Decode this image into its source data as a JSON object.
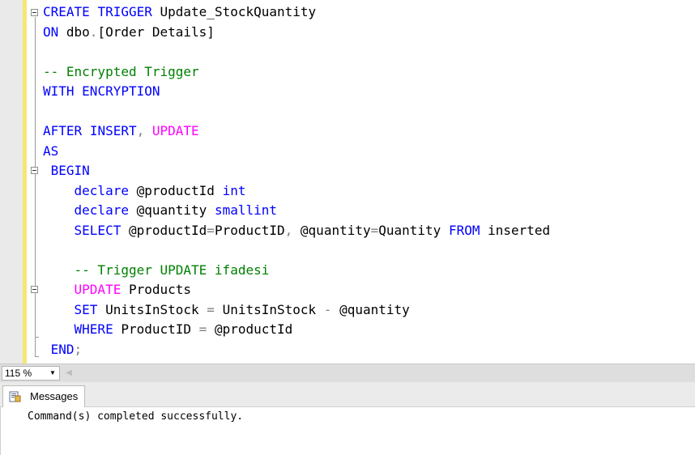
{
  "editor": {
    "lines": [
      [
        {
          "t": "CREATE",
          "c": "kw"
        },
        {
          "t": " ",
          "c": "tx"
        },
        {
          "t": "TRIGGER",
          "c": "kw"
        },
        {
          "t": " Update_StockQuantity",
          "c": "tx"
        }
      ],
      [
        {
          "t": "ON",
          "c": "kw"
        },
        {
          "t": " dbo",
          "c": "tx"
        },
        {
          "t": ".",
          "c": "op"
        },
        {
          "t": "[Order Details]",
          "c": "tx"
        }
      ],
      [],
      [
        {
          "t": "-- Encrypted Trigger",
          "c": "cm"
        }
      ],
      [
        {
          "t": "WITH",
          "c": "kw"
        },
        {
          "t": " ",
          "c": "tx"
        },
        {
          "t": "ENCRYPTION",
          "c": "kw"
        }
      ],
      [],
      [
        {
          "t": "AFTER",
          "c": "kw"
        },
        {
          "t": " ",
          "c": "tx"
        },
        {
          "t": "INSERT",
          "c": "kw"
        },
        {
          "t": ",",
          "c": "op"
        },
        {
          "t": " ",
          "c": "tx"
        },
        {
          "t": "UPDATE",
          "c": "pk"
        }
      ],
      [
        {
          "t": "AS",
          "c": "kw"
        }
      ],
      [
        {
          "t": " BEGIN",
          "c": "kw"
        }
      ],
      [
        {
          "t": "    ",
          "c": "tx"
        },
        {
          "t": "declare",
          "c": "kw"
        },
        {
          "t": " @productId ",
          "c": "tx"
        },
        {
          "t": "int",
          "c": "kw"
        }
      ],
      [
        {
          "t": "    ",
          "c": "tx"
        },
        {
          "t": "declare",
          "c": "kw"
        },
        {
          "t": " @quantity ",
          "c": "tx"
        },
        {
          "t": "smallint",
          "c": "kw"
        }
      ],
      [
        {
          "t": "    ",
          "c": "tx"
        },
        {
          "t": "SELECT",
          "c": "kw"
        },
        {
          "t": " @productId",
          "c": "tx"
        },
        {
          "t": "=",
          "c": "op"
        },
        {
          "t": "ProductID",
          "c": "tx"
        },
        {
          "t": ",",
          "c": "op"
        },
        {
          "t": " @quantity",
          "c": "tx"
        },
        {
          "t": "=",
          "c": "op"
        },
        {
          "t": "Quantity ",
          "c": "tx"
        },
        {
          "t": "FROM",
          "c": "kw"
        },
        {
          "t": " inserted",
          "c": "tx"
        }
      ],
      [],
      [
        {
          "t": "    ",
          "c": "tx"
        },
        {
          "t": "-- Trigger UPDATE ifadesi",
          "c": "cm"
        }
      ],
      [
        {
          "t": "    ",
          "c": "tx"
        },
        {
          "t": "UPDATE",
          "c": "pk"
        },
        {
          "t": " Products",
          "c": "tx"
        }
      ],
      [
        {
          "t": "    ",
          "c": "tx"
        },
        {
          "t": "SET",
          "c": "kw"
        },
        {
          "t": " UnitsInStock ",
          "c": "tx"
        },
        {
          "t": "=",
          "c": "op"
        },
        {
          "t": " UnitsInStock ",
          "c": "tx"
        },
        {
          "t": "-",
          "c": "op"
        },
        {
          "t": " @quantity",
          "c": "tx"
        }
      ],
      [
        {
          "t": "    ",
          "c": "tx"
        },
        {
          "t": "WHERE",
          "c": "kw"
        },
        {
          "t": " ProductID ",
          "c": "tx"
        },
        {
          "t": "=",
          "c": "op"
        },
        {
          "t": " @productId",
          "c": "tx"
        }
      ],
      [
        {
          "t": " END",
          "c": "kw"
        },
        {
          "t": ";",
          "c": "op"
        }
      ]
    ]
  },
  "zoom": {
    "value": "115 %"
  },
  "results": {
    "tab_label": "Messages",
    "message": "Command(s) completed successfully."
  }
}
